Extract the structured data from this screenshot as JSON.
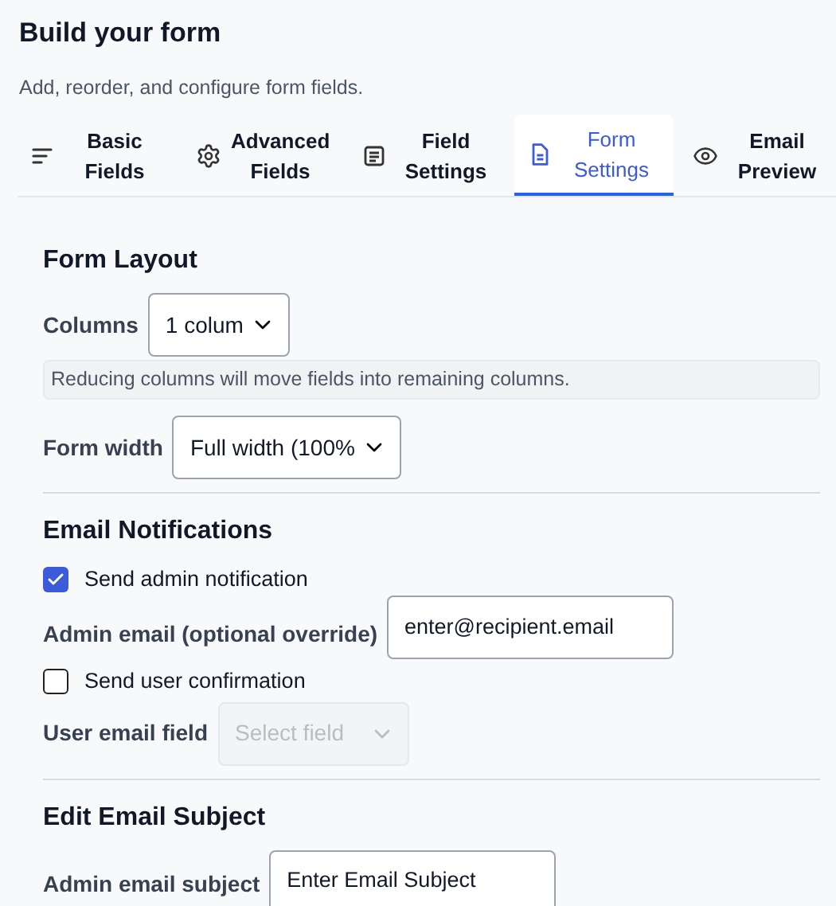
{
  "header": {
    "title": "Build your form",
    "subtitle": "Add, reorder, and configure form fields."
  },
  "tabs": [
    {
      "kind": "lines",
      "label": "Basic Fields",
      "selected": false
    },
    {
      "kind": "gear",
      "label": "Advanced Fields",
      "selected": false
    },
    {
      "kind": "note",
      "label": "Field Settings",
      "selected": false
    },
    {
      "kind": "file",
      "label": "Form Settings",
      "selected": true
    },
    {
      "kind": "eye",
      "label": "Email Preview",
      "selected": false
    }
  ],
  "form_layout": {
    "heading": "Form Layout",
    "columns": {
      "label": "Columns",
      "value": "1 colum"
    },
    "note": "Reducing columns will move fields into remaining columns.",
    "form_width": {
      "label": "Form width",
      "value": "Full width (100%"
    }
  },
  "email_notifications": {
    "heading": "Email Notifications",
    "admin_notification": {
      "label": "Send admin notification",
      "checked": true
    },
    "admin_email": {
      "label": "Admin email (optional override)",
      "value": "enter@recipient.email"
    },
    "user_confirmation": {
      "label": "Send user confirmation",
      "checked": false
    },
    "user_email_field": {
      "label": "User email field",
      "placeholder": "Select field",
      "disabled": true
    }
  },
  "email_subject": {
    "heading": "Edit Email Subject",
    "admin_subject": {
      "label": "Admin email subject",
      "value": "Enter Email Subject"
    }
  }
}
